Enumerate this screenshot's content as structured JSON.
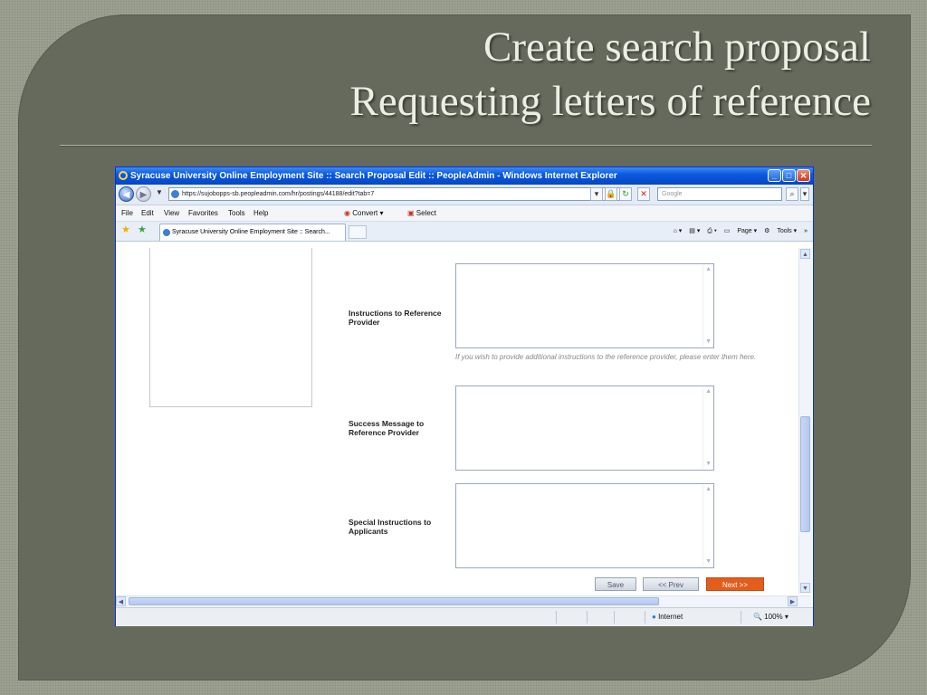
{
  "slide": {
    "title_line1": "Create search proposal",
    "title_line2": "Requesting letters of reference"
  },
  "browser": {
    "window_title": "Syracuse University Online Employment Site :: Search Proposal Edit :: PeopleAdmin - Windows Internet Explorer",
    "url": "https://sujobopps-sb.peopleadmin.com/hr/postings/44188/edit?tab=7",
    "search_placeholder": "Google",
    "menu": [
      "File",
      "Edit",
      "View",
      "Favorites",
      "Tools",
      "Help"
    ],
    "convert_label": "Convert",
    "select_label": "Select",
    "tab_title": "Syracuse University Online Employment Site :: Search...",
    "page_label": "Page",
    "tools_label": "Tools",
    "status_zone": "Internet",
    "zoom": "100%"
  },
  "form": {
    "fields": [
      {
        "label": "Instructions to Reference Provider",
        "help": "If you wish to provide additional instructions to the reference provider, please enter them here."
      },
      {
        "label": "Success Message to Reference Provider"
      },
      {
        "label": "Special Instructions to Applicants"
      }
    ],
    "buttons": {
      "save": "Save",
      "prev": "<< Prev",
      "next": "Next >>"
    }
  },
  "colors": {
    "slide_bg": "#666a5c",
    "title_text": "#eceee4",
    "next_button": "#e35d1c",
    "titlebar_blue": "#0a5ae0"
  }
}
